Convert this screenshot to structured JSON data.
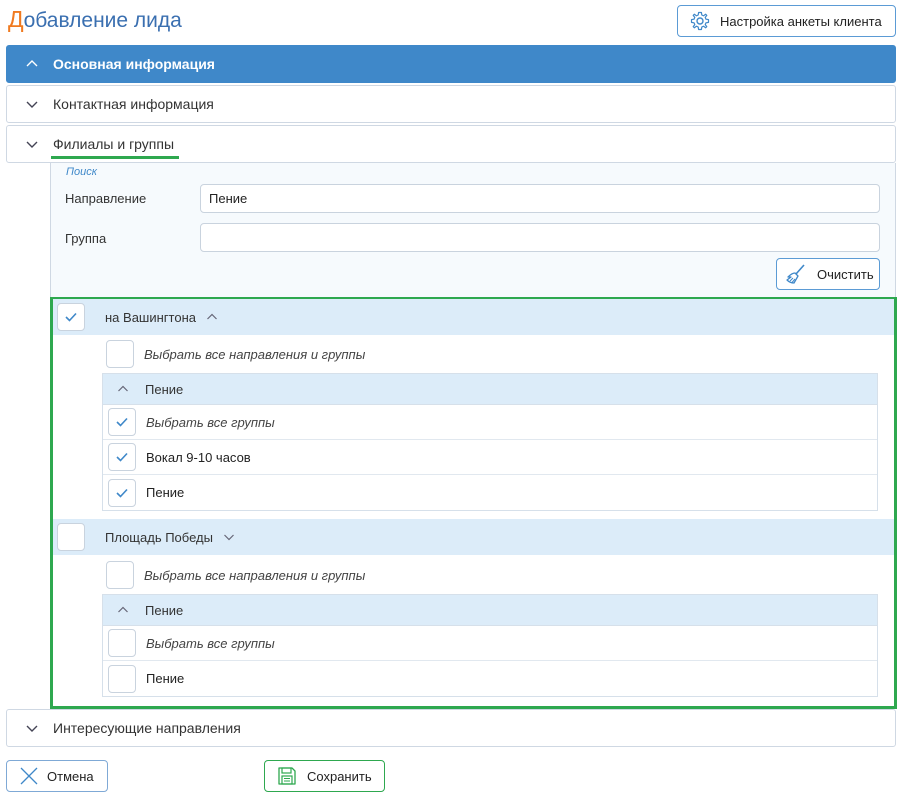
{
  "page": {
    "title_first_letter": "Д",
    "title_rest": "обавление лида"
  },
  "toolbar": {
    "settings_label": "Настройка анкеты клиента"
  },
  "accordion": {
    "main_info": "Основная информация",
    "contact_info": "Контактная информация",
    "branches_groups": "Филиалы и группы",
    "interests": "Интересующие направления"
  },
  "search": {
    "caption": "Поиск",
    "direction_label": "Направление",
    "direction_value": "Пение",
    "group_label": "Группа",
    "group_value": "",
    "clear_label": "Очистить"
  },
  "branches": [
    {
      "name": "на Вашингтона",
      "checked": true,
      "select_all_label": "Выбрать все направления и группы",
      "direction": "Пение",
      "rows": [
        {
          "label": "Выбрать все группы",
          "checked": true
        },
        {
          "label": "Вокал 9-10 часов",
          "checked": true
        },
        {
          "label": "Пение",
          "checked": true
        }
      ]
    },
    {
      "name": "Площадь Победы",
      "checked": false,
      "select_all_label": "Выбрать все направления и группы",
      "direction": "Пение",
      "rows": [
        {
          "label": "Выбрать все группы",
          "checked": false
        },
        {
          "label": "Пение",
          "checked": false
        }
      ]
    }
  ],
  "footer": {
    "cancel_label": "Отмена",
    "save_label": "Сохранить"
  },
  "colors": {
    "accent": "#3f88c9",
    "highlight": "#2ea84f",
    "title_first": "#f07a20"
  }
}
